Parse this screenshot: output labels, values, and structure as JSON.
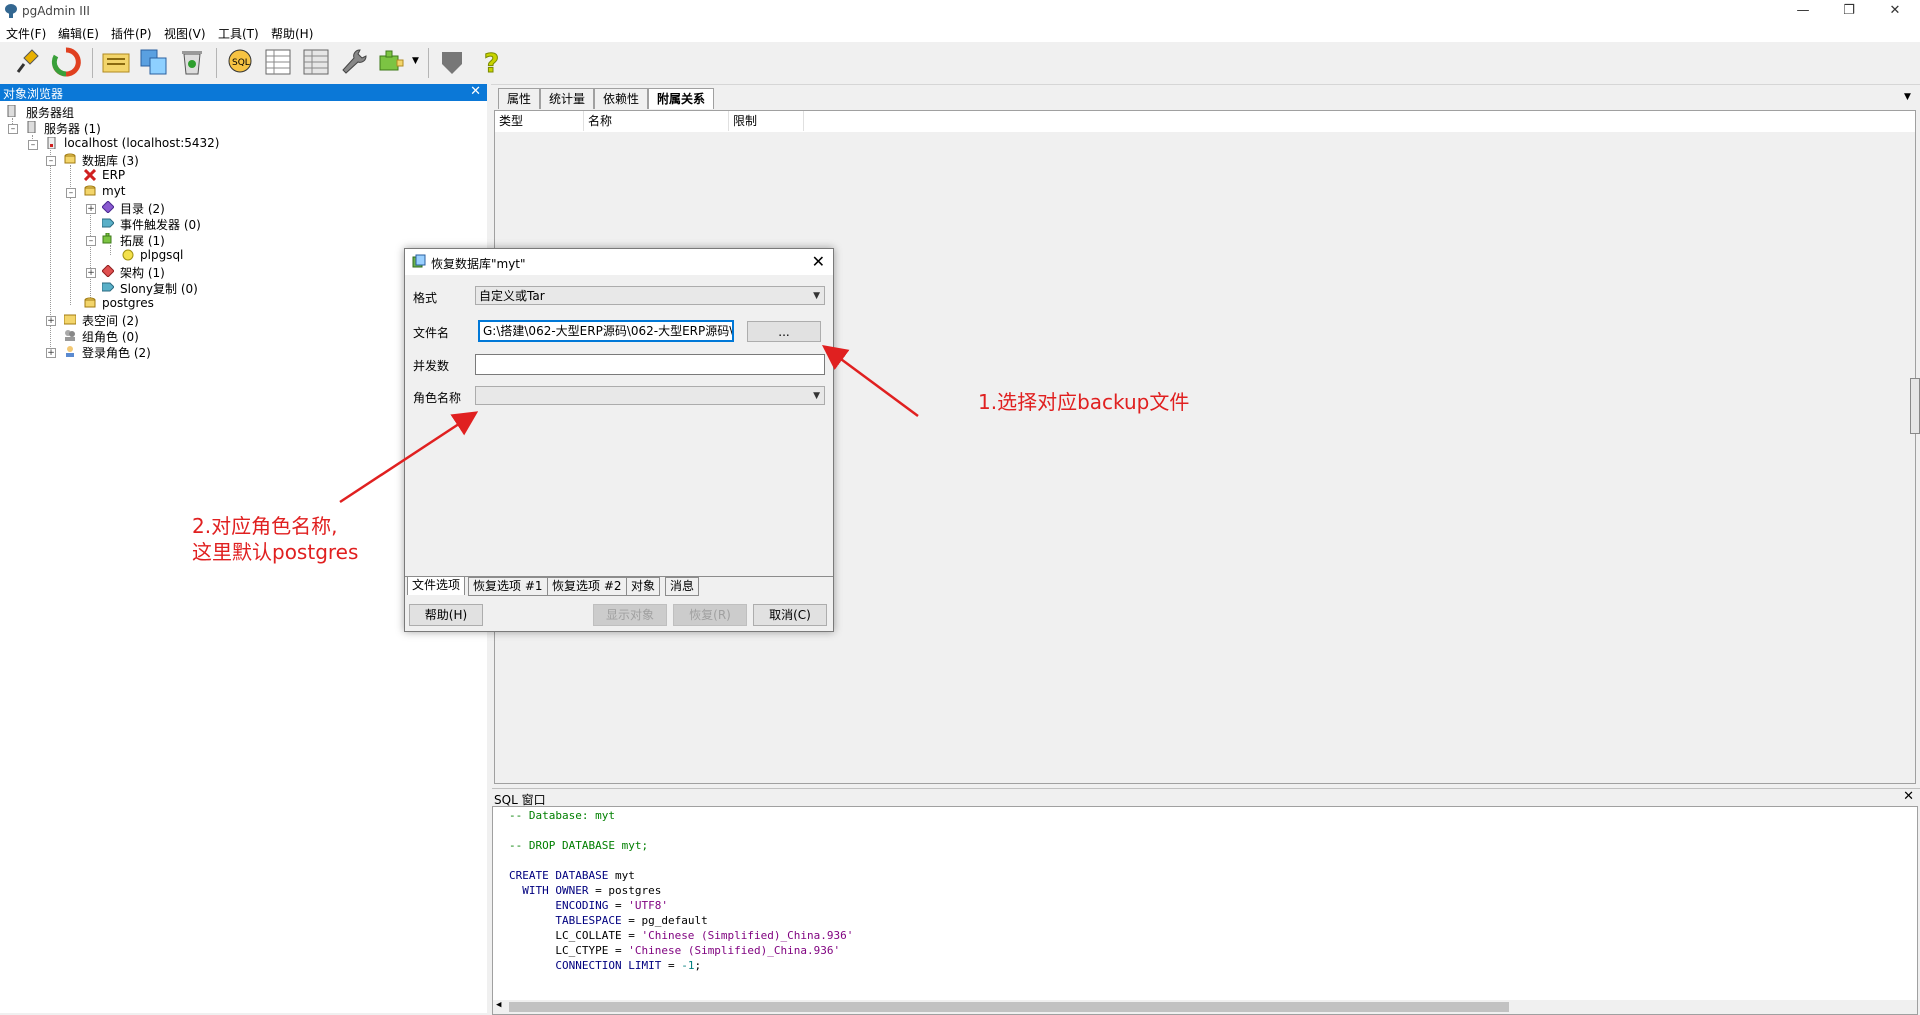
{
  "window": {
    "title": "pgAdmin III",
    "controls": [
      "minimize",
      "restore",
      "close"
    ]
  },
  "menu": [
    "文件(F)",
    "编辑(E)",
    "插件(P)",
    "视图(V)",
    "工具(T)",
    "帮助(H)"
  ],
  "toolbar": {
    "buttons": [
      "connect-icon",
      "refresh-icon",
      "properties-icon",
      "create-icon",
      "drop-icon",
      "sql-icon",
      "view-data-icon",
      "filtered-data-icon",
      "maintenance-icon",
      "plugins-icon",
      "hint-icon",
      "help-icon"
    ]
  },
  "object_browser": {
    "title": "对象浏览器",
    "tree": [
      {
        "label": "服务器组"
      },
      {
        "label": "服务器 (1)"
      },
      {
        "label": "localhost (localhost:5432)"
      },
      {
        "label": "数据库 (3)"
      },
      {
        "label": "ERP"
      },
      {
        "label": "myt"
      },
      {
        "label": "目录 (2)"
      },
      {
        "label": "事件触发器 (0)"
      },
      {
        "label": "拓展 (1)"
      },
      {
        "label": "plpgsql"
      },
      {
        "label": "架构 (1)"
      },
      {
        "label": "Slony复制 (0)"
      },
      {
        "label": "postgres"
      },
      {
        "label": "表空间 (2)"
      },
      {
        "label": "组角色 (0)"
      },
      {
        "label": "登录角色 (2)"
      }
    ]
  },
  "properties": {
    "tabs": [
      "属性",
      "统计量",
      "依赖性",
      "附属关系"
    ],
    "active_tab": "附属关系",
    "columns": [
      "类型",
      "名称",
      "限制"
    ]
  },
  "sql_window": {
    "title": "SQL 窗口",
    "lines": [
      "-- Database: myt",
      "",
      "-- DROP DATABASE myt;",
      "",
      "CREATE DATABASE myt",
      "  WITH OWNER = postgres",
      "       ENCODING = 'UTF8'",
      "       TABLESPACE = pg_default",
      "       LC_COLLATE = 'Chinese (Simplified)_China.936'",
      "       LC_CTYPE = 'Chinese (Simplified)_China.936'",
      "       CONNECTION LIMIT = -1;"
    ]
  },
  "dialog": {
    "title": "恢复数据库\"myt\"",
    "format_label": "格式",
    "format_value": "自定义或Tar",
    "filename_label": "文件名",
    "filename_value": "G:\\搭建\\062-大型ERP源码\\062-大型ERP源码\\I",
    "browse_label": "...",
    "jobs_label": "并发数",
    "jobs_value": "",
    "role_label": "角色名称",
    "role_value": "",
    "tabs": [
      "文件选项",
      "恢复选项 #1",
      "恢复选项 #2",
      "对象",
      "消息"
    ],
    "active_tab": "文件选项",
    "help_button": "帮助(H)",
    "show_objects_button": "显示对象",
    "restore_button": "恢复(R)",
    "cancel_button": "取消(C)"
  },
  "annotations": {
    "note1": "1.选择对应backup文件",
    "note2_line1": "2.对应角色名称,",
    "note2_line2": "这里默认postgres",
    "color": "#e02020"
  }
}
